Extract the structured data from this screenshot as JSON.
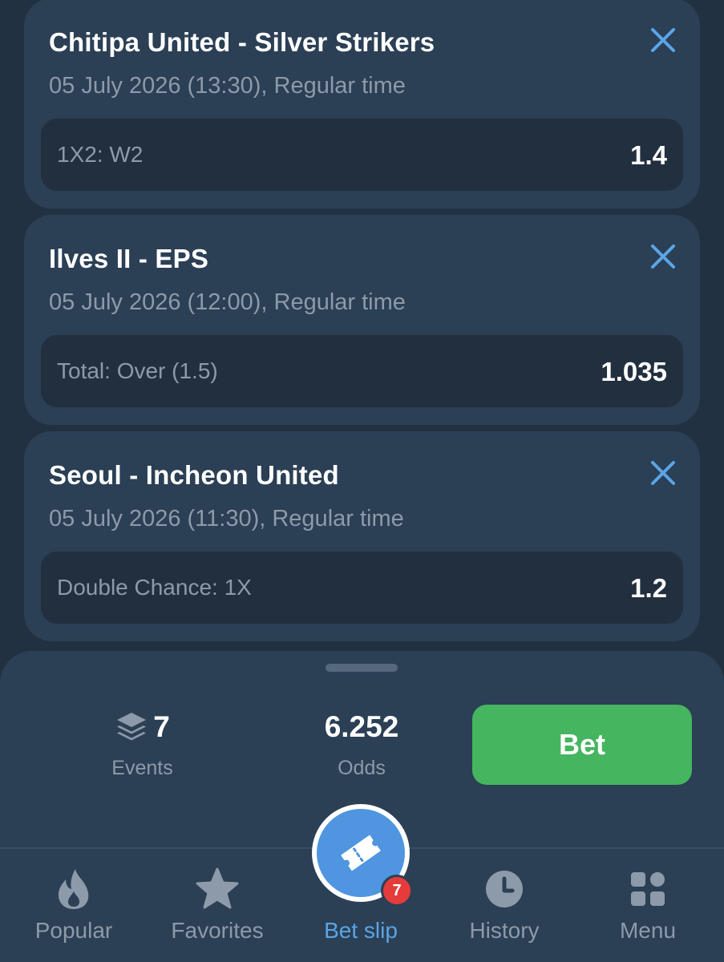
{
  "bets": [
    {
      "teams": "Chitipa United - Silver Strikers",
      "datetime": "05 July 2026 (13:30), Regular time",
      "market": "1X2: W2",
      "odds": "1.4"
    },
    {
      "teams": "Ilves II - EPS",
      "datetime": "05 July 2026 (12:00), Regular time",
      "market": "Total: Over (1.5)",
      "odds": "1.035"
    },
    {
      "teams": "Seoul - Incheon United",
      "datetime": "05 July 2026 (11:30), Regular time",
      "market": "Double Chance: 1X",
      "odds": "1.2"
    }
  ],
  "summary": {
    "events_count": "7",
    "events_label": "Events",
    "total_odds": "6.252",
    "odds_label": "Odds",
    "bet_button_label": "Bet"
  },
  "nav": {
    "popular": "Popular",
    "favorites": "Favorites",
    "betslip": "Bet slip",
    "history": "History",
    "menu": "Menu",
    "betslip_badge": "7"
  },
  "colors": {
    "background": "#213142",
    "card": "#2b3f55",
    "row": "#222f3f",
    "accent_blue": "#5aa5e6",
    "bet_green": "#45b55f",
    "badge_red": "#e53b3b",
    "muted_text": "#8d9aa9"
  },
  "icons": {
    "close": "close-icon",
    "events": "layers-icon",
    "popular": "flame-icon",
    "favorites": "star-icon",
    "betslip": "ticket-icon",
    "history": "clock-icon",
    "menu": "grid-icon"
  }
}
